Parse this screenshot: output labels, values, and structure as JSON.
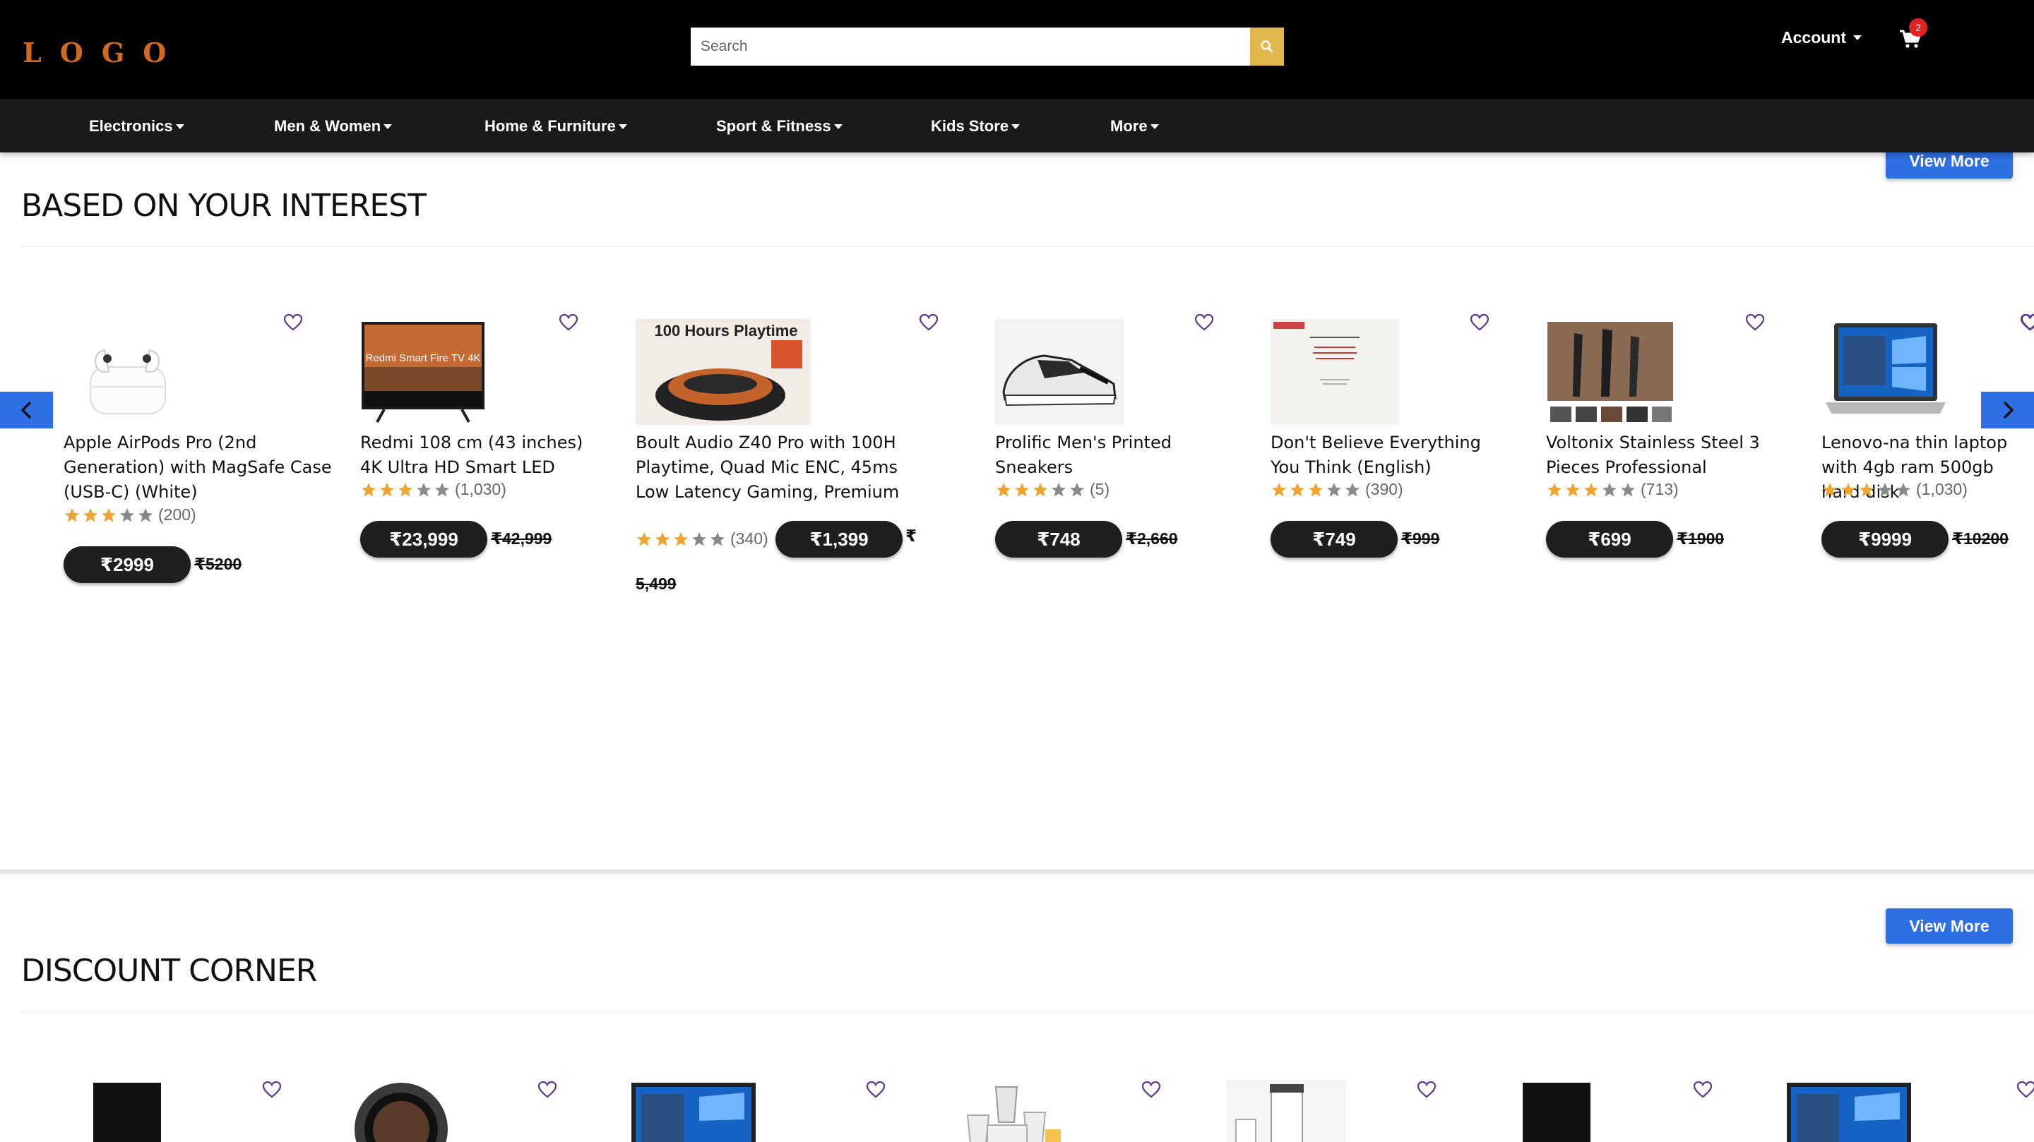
{
  "header": {
    "logo": "LOGO",
    "search_placeholder": "Search",
    "account_label": "Account",
    "cart_count": "2",
    "colors": {
      "background": "#000000",
      "logo": "#d2691e",
      "search_button": "#e0b84c",
      "badge": "#e02424"
    }
  },
  "nav": {
    "items": [
      {
        "label": "Electronics"
      },
      {
        "label": "Men & Women"
      },
      {
        "label": "Home & Furniture"
      },
      {
        "label": "Sport & Fitness"
      },
      {
        "label": "Kids Store"
      },
      {
        "label": "More"
      }
    ]
  },
  "interest": {
    "title": "BASED ON YOUR INTEREST",
    "view_more": "View More",
    "products": [
      {
        "name": "Apple AirPods Pro (2nd Generation) with MagSafe Case (USB-C) (White)",
        "rating": 3,
        "reviews": "(200)",
        "price": "₹2999",
        "old_price": "₹5200",
        "image_icon": "earbuds-icon"
      },
      {
        "name": "Redmi 108 cm (43 inches) 4K Ultra HD Smart LED",
        "rating": 3,
        "reviews": "(1,030)",
        "price": "₹23,999",
        "old_price": "₹42,999",
        "image_icon": "tv-icon",
        "image_text": "Redmi Smart Fire TV 4K"
      },
      {
        "name": "Boult Audio Z40 Pro with 100H Playtime, Quad Mic ENC, 45ms Low Latency Gaming, Premium",
        "rating": 3,
        "reviews": "(340)",
        "price": "₹1,399",
        "old_price_part1": "₹",
        "old_price_part2": "5,499",
        "image_icon": "tws-case-icon",
        "image_text": "100 Hours Playtime"
      },
      {
        "name": "Prolific Men's Printed Sneakers",
        "rating": 3,
        "reviews": "(5)",
        "price": "₹748",
        "old_price": "₹2,660",
        "image_icon": "sneaker-icon"
      },
      {
        "name": "Don't Believe Everything You Think (English)",
        "rating": 3,
        "reviews": "(390)",
        "price": "₹749",
        "old_price": "₹999",
        "image_icon": "book-icon"
      },
      {
        "name": "Voltonix Stainless Steel 3 Pieces Professional",
        "rating": 3,
        "reviews": "(713)",
        "price": "₹699",
        "old_price": "₹1900",
        "image_icon": "knife-set-icon"
      },
      {
        "name": "Lenovo-na thin laptop with 4gb ram 500gb hard disk",
        "rating": 3,
        "reviews": "(1,030)",
        "price": "₹9999",
        "old_price": "₹10200",
        "image_icon": "laptop-icon"
      }
    ]
  },
  "discount": {
    "title": "DISCOUNT CORNER",
    "view_more": "View More",
    "thumbnails": [
      "black-pad-icon",
      "smartwatch-icon",
      "laptop-icon",
      "mixer-grinder-icon",
      "bottle-icon",
      "black-pad-icon",
      "laptop-icon"
    ]
  },
  "colors": {
    "accent": "#2f6fe4",
    "star_on": "#f0a430",
    "star_off": "#8a8a8a",
    "pill": "#1f1f1f"
  }
}
